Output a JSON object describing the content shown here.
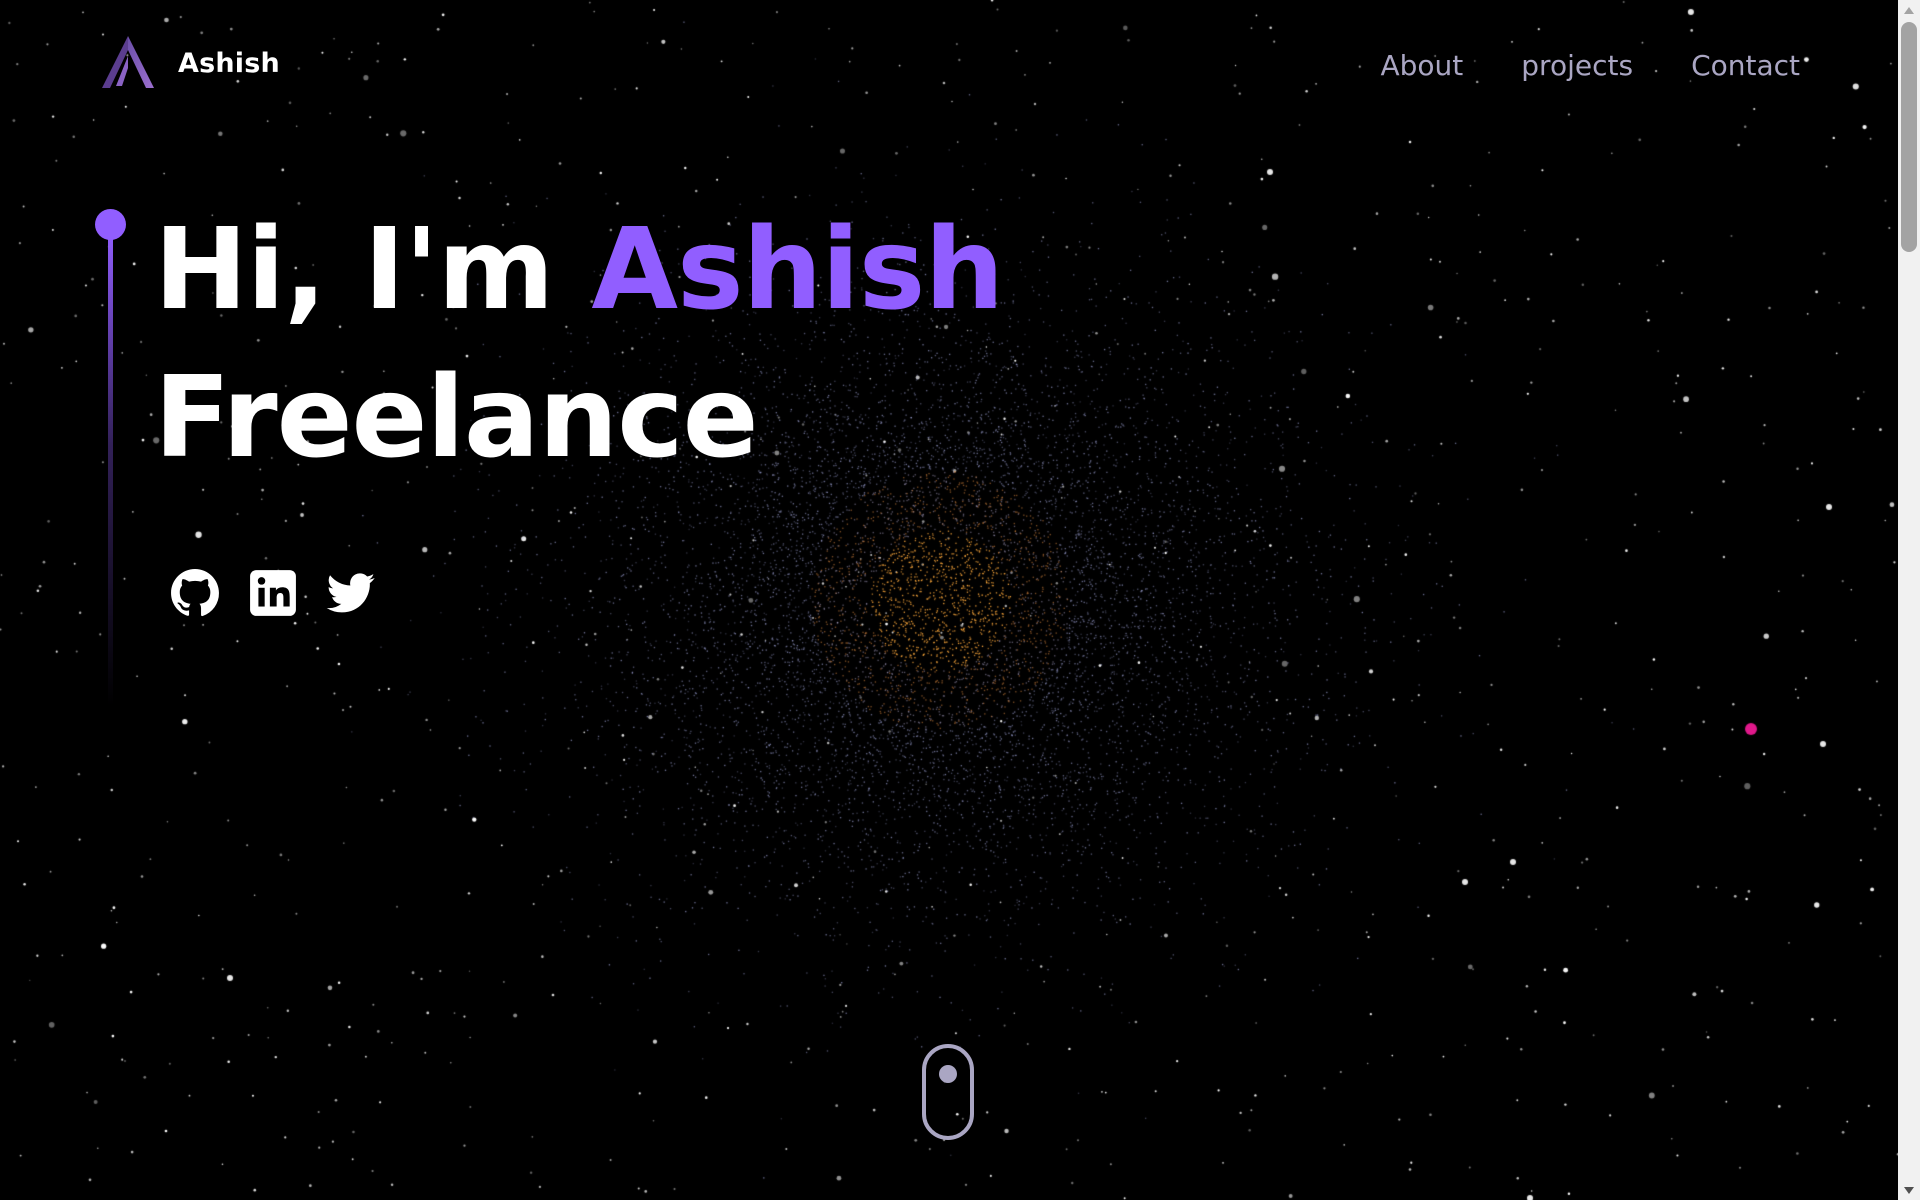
{
  "brand": {
    "name": "Ashish",
    "logo_icon": "triangle-a-logo-icon"
  },
  "nav": {
    "links": [
      {
        "label": "About"
      },
      {
        "label": "projects"
      },
      {
        "label": "Contact"
      }
    ]
  },
  "hero": {
    "greeting": "Hi, I'm ",
    "name": "Ashish",
    "subtitle": "Freelance"
  },
  "socials": [
    {
      "name": "github-icon"
    },
    {
      "name": "linkedin-icon"
    },
    {
      "name": "twitter-icon"
    }
  ],
  "scroll_indicator": {
    "icon": "mouse-scroll-icon"
  },
  "colors": {
    "background": "#000000",
    "accent": "#915eff",
    "text_primary": "#ffffff",
    "text_secondary": "#aaa6c3",
    "pink_dot": "#e0188a"
  }
}
